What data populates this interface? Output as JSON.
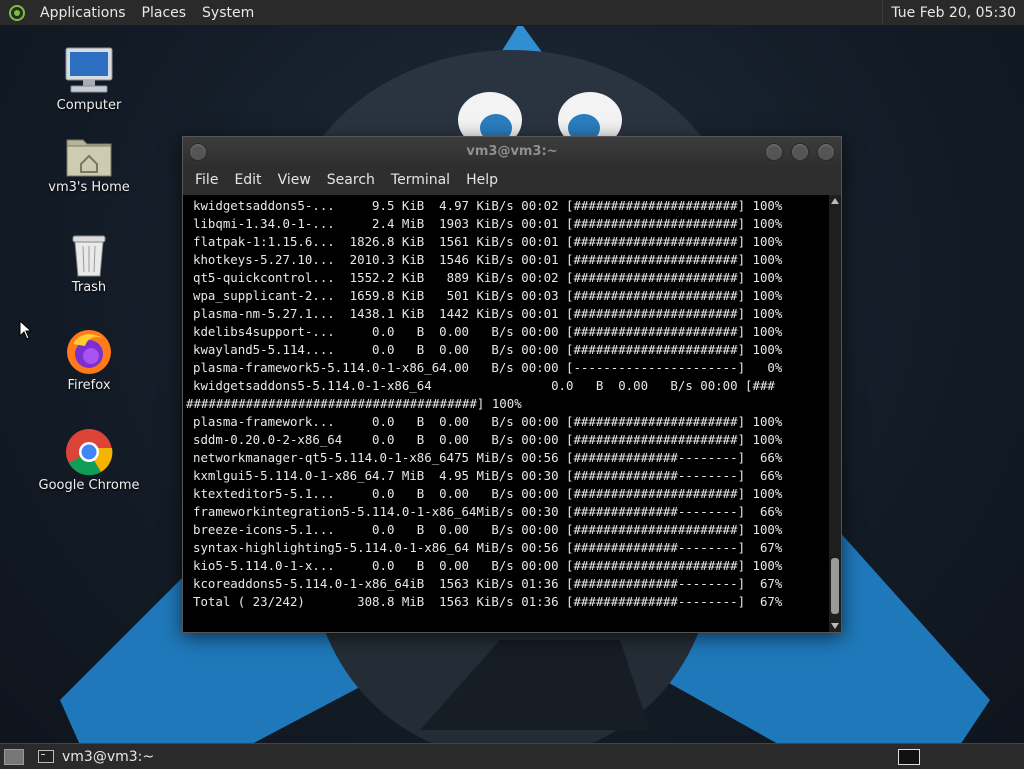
{
  "top_panel": {
    "menus": [
      "Applications",
      "Places",
      "System"
    ],
    "clock": "Tue Feb 20, 05:30"
  },
  "desktop_icons": [
    {
      "label": "Computer",
      "icon": "computer-icon"
    },
    {
      "label": "vm3's Home",
      "icon": "home-folder-icon"
    },
    {
      "label": "Trash",
      "icon": "trash-icon"
    },
    {
      "label": "Firefox",
      "icon": "firefox-icon"
    },
    {
      "label": "Google Chrome",
      "icon": "chrome-icon"
    }
  ],
  "terminal": {
    "title": "vm3@vm3:~",
    "menu": [
      "File",
      "Edit",
      "View",
      "Search",
      "Terminal",
      "Help"
    ],
    "lines": [
      "kwidgetsaddons5-...     9.5 KiB  4.97 KiB/s 00:02 [######################] 100%",
      "libqmi-1.34.0-1-...     2.4 MiB  1903 KiB/s 00:01 [######################] 100%",
      "flatpak-1:1.15.6...  1826.8 KiB  1561 KiB/s 00:01 [######################] 100%",
      "khotkeys-5.27.10...  2010.3 KiB  1546 KiB/s 00:01 [######################] 100%",
      "qt5-quickcontrol...  1552.2 KiB   889 KiB/s 00:02 [######################] 100%",
      "wpa_supplicant-2...  1659.8 KiB   501 KiB/s 00:03 [######################] 100%",
      "plasma-nm-5.27.1...  1438.1 KiB  1442 KiB/s 00:01 [######################] 100%",
      "kdelibs4support-...     0.0   B  0.00   B/s 00:00 [######################] 100%",
      "kwayland5-5.114....     0.0   B  0.00   B/s 00:00 [######################] 100%",
      "plasma-framework5-5.114.0-1-x86_64.00   B/s 00:00 [----------------------]   0%",
      "kwidgetsaddons5-5.114.0-1-x86_64                0.0   B  0.00   B/s 00:00 [###",
      "#######################################] 100%",
      "plasma-framework...     0.0   B  0.00   B/s 00:00 [######################] 100%",
      "sddm-0.20.0-2-x86_64    0.0   B  0.00   B/s 00:00 [######################] 100%",
      "networkmanager-qt5-5.114.0-1-x86_6475 MiB/s 00:56 [##############--------]  66%",
      "kxmlgui5-5.114.0-1-x86_64.7 MiB  4.95 MiB/s 00:30 [##############--------]  66%",
      "ktexteditor5-5.1...     0.0   B  0.00   B/s 00:00 [######################] 100%",
      "frameworkintegration5-5.114.0-1-x86_64MiB/s 00:30 [##############--------]  66%",
      "breeze-icons-5.1...     0.0   B  0.00   B/s 00:00 [######################] 100%",
      "syntax-highlighting5-5.114.0-1-x86_64 MiB/s 00:56 [##############--------]  67%",
      "kio5-5.114.0-1-x...     0.0   B  0.00   B/s 00:00 [######################] 100%",
      "kcoreaddons5-5.114.0-1-x86_64iB  1563 KiB/s 01:36 [##############--------]  67%",
      "Total ( 23/242)       308.8 MiB  1563 KiB/s 01:36 [##############--------]  67%"
    ]
  },
  "bottom_panel": {
    "task_label": "vm3@vm3:~"
  }
}
